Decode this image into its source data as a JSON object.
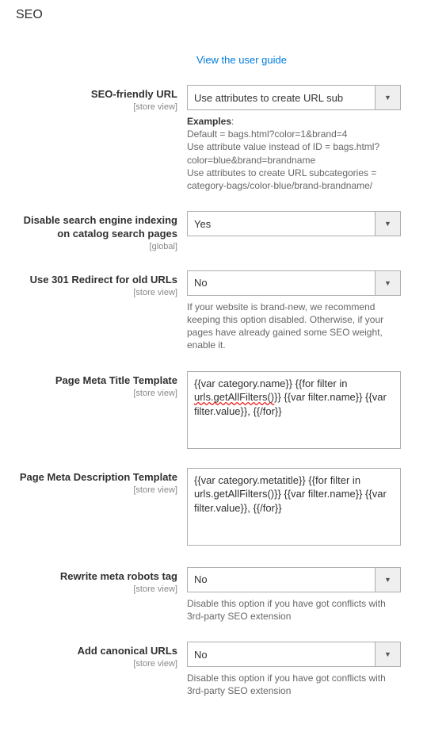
{
  "section_title": "SEO",
  "user_guide_link": "View the user guide",
  "fields": {
    "seo_friendly_url": {
      "label": "SEO-friendly URL",
      "scope": "[store view]",
      "value": "Use attributes to create URL sub",
      "note_title": "Examples",
      "note_line1": "Default = bags.html?color=1&brand=4",
      "note_line2": "Use attribute value instead of ID = bags.html?color=blue&brand=brandname",
      "note_line3": "Use attributes to create URL subcategories = category-bags/color-blue/brand-brandname/"
    },
    "disable_indexing": {
      "label": "Disable search engine indexing on catalog search pages",
      "scope": "[global]",
      "value": "Yes"
    },
    "use_301": {
      "label": "Use 301 Redirect for old URLs",
      "scope": "[store view]",
      "value": "No",
      "note": "If your website is brand-new, we recommend keeping this option disabled. Otherwise, if your pages have already gained some SEO weight, enable it."
    },
    "meta_title_tpl": {
      "label": "Page Meta Title Template",
      "scope": "[store view]",
      "value_pre": "{{var category.name}} {{for filter in ",
      "value_misspell": "urls.getAllFilters()",
      "value_post": "}} {{var filter.name}} {{var filter.value}}, {{/for}}"
    },
    "meta_desc_tpl": {
      "label": "Page Meta Description Template",
      "scope": "[store view]",
      "value": "{{var category.metatitle}} {{for filter in urls.getAllFilters()}} {{var filter.name}} {{var filter.value}}, {{/for}}"
    },
    "rewrite_robots": {
      "label": "Rewrite meta robots tag",
      "scope": "[store view]",
      "value": "No",
      "note": "Disable this option if you have got conflicts with 3rd-party SEO extension"
    },
    "add_canonical": {
      "label": "Add canonical URLs",
      "scope": "[store view]",
      "value": "No",
      "note": "Disable this option if you have got conflicts with 3rd-party SEO extension"
    }
  }
}
